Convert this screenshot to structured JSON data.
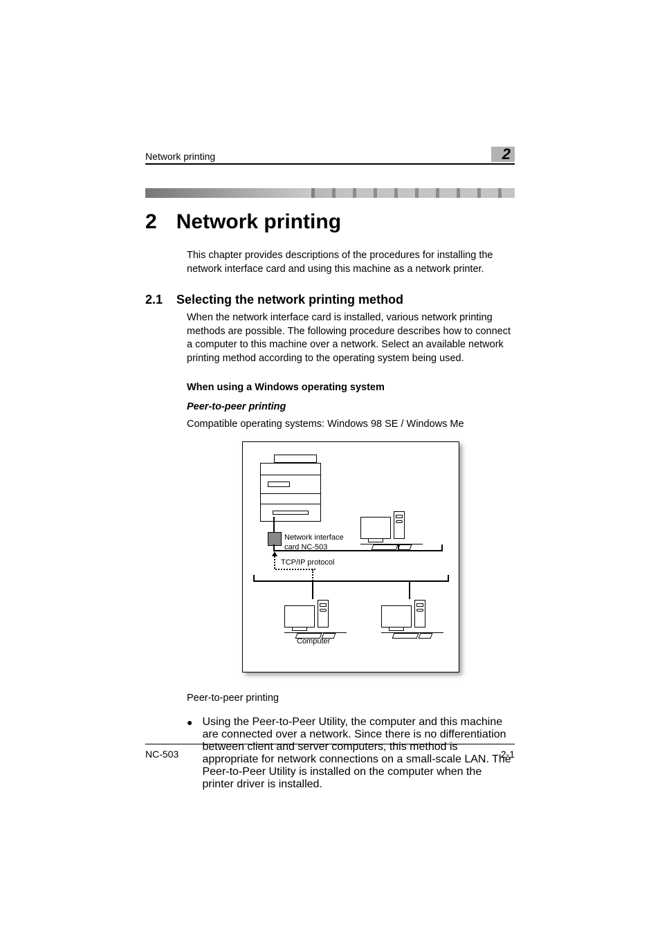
{
  "header": {
    "running_title": "Network printing",
    "chapter_number": "2"
  },
  "h1": {
    "number": "2",
    "title": "Network printing"
  },
  "intro": "This chapter provides descriptions of the procedures for installing the network interface card and using this machine as a network printer.",
  "h2": {
    "number": "2.1",
    "title": "Selecting the network printing method"
  },
  "h2_body": "When the network interface card is installed, various network printing methods are possible. The following procedure describes how to connect a computer to this machine over a network. Select an available network printing method according to the operating system being used.",
  "subhead_bold": "When using a Windows operating system",
  "subhead_italic": "Peer-to-peer printing",
  "compat_line": "Compatible operating systems: Windows 98 SE / Windows Me",
  "diagram": {
    "nic_label_1": "Network interface",
    "nic_label_2": "card NC-503",
    "protocol_label": "TCP/IP protocol",
    "computer_label": "Computer"
  },
  "after_diagram_heading": "Peer-to-peer printing",
  "bullet_text": "Using the Peer-to-Peer Utility, the computer and this machine are connected over a network. Since there is no differentiation between client and server computers, this method is appropriate for network connections on a small-scale LAN. The Peer-to-Peer Utility is installed on the computer when the printer driver is installed.",
  "footer": {
    "left": "NC-503",
    "right": "2-1"
  }
}
